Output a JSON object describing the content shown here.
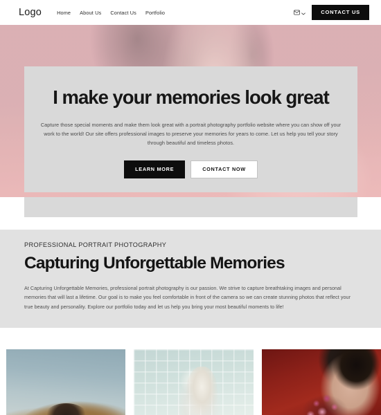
{
  "navbar": {
    "logo": "Logo",
    "links": [
      {
        "label": "Home"
      },
      {
        "label": "About Us"
      },
      {
        "label": "Contact Us"
      },
      {
        "label": "Portfolio"
      }
    ],
    "mail_icon": "mail-icon",
    "chevron_icon": "chevron-down-icon",
    "cta_label": "CONTACT US"
  },
  "hero": {
    "title": "I make your memories look great",
    "subtitle": "Capture those special moments and make them look great with a portrait photography portfolio website where you can show off your work to the world! Our site offers professional images to preserve your memories for years to come. Let us help you tell your story through beautiful and timeless photos.",
    "primary_button": "LEARN MORE",
    "secondary_button": "CONTACT NOW"
  },
  "about": {
    "eyebrow": "PROFESSIONAL PORTRAIT PHOTOGRAPHY",
    "title": "Capturing Unforgettable Memories",
    "body": "At Capturing Unforgettable Memories, professional portrait photography is our passion. We strive to capture breathtaking images and personal memories that will last a lifetime. Our goal is to make you feel comfortable in front of the camera so we can create stunning photos that reflect your true beauty and personality. Explore our portfolio today and let us help you bring your most beautiful moments to life!"
  },
  "gallery": {
    "items": [
      {
        "name": "portrait-dune-blue-sky"
      },
      {
        "name": "portrait-glass-block-wall"
      },
      {
        "name": "portrait-red-backdrop-flowers"
      }
    ]
  },
  "colors": {
    "hero_pink": "#dcafb4",
    "card_gray": "#d9d9d9",
    "section_gray": "#e1e1e1",
    "accent_black": "#0d0d0d",
    "page_white": "#ffffff"
  }
}
